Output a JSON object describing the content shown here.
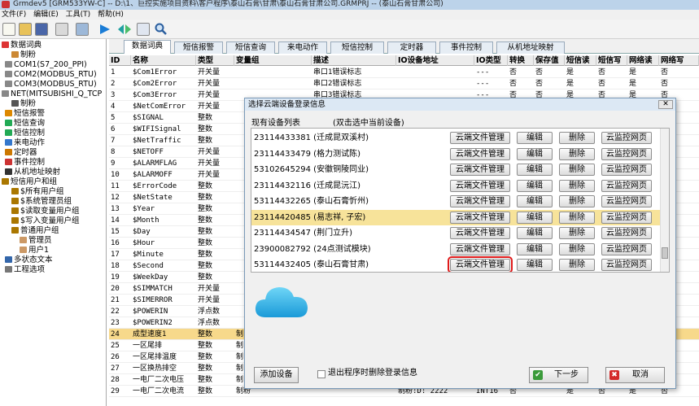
{
  "window": {
    "title": "Grmdev5 [GRM533YW-C] -- D:\\1、巨控实施项目资料\\客户程序\\泰山石膏\\甘肃\\泰山石膏甘肃公司.GRMPRJ -- (泰山石膏甘肃公司)"
  },
  "menu": [
    "文件(F)",
    "编辑(E)",
    "工具(T)",
    "帮助(H)"
  ],
  "tree": [
    {
      "label": "数据词典",
      "color": "#d33"
    },
    {
      "label": "制粉",
      "color": "#c83"
    },
    {
      "label": "COM1(S7_200_PPI)",
      "color": "#888"
    },
    {
      "label": "COM2(MODBUS_RTU)",
      "color": "#888"
    },
    {
      "label": "COM3(MODBUS_RTU)",
      "color": "#888"
    },
    {
      "label": "NET(MITSUBISHI_Q_TCP",
      "color": "#888"
    },
    {
      "label": "制粉",
      "color": "#555"
    },
    {
      "label": "短信报警",
      "color": "#d80"
    },
    {
      "label": "短信查询",
      "color": "#2a5"
    },
    {
      "label": "短信控制",
      "color": "#2a5"
    },
    {
      "label": "来电动作",
      "color": "#37c"
    },
    {
      "label": "定时器",
      "color": "#c70"
    },
    {
      "label": "事件控制",
      "color": "#c33"
    },
    {
      "label": "从机地址映射",
      "color": "#333"
    },
    {
      "label": "短信用户和组",
      "color": "#a70"
    },
    {
      "label": "$所有用户组",
      "color": "#a70"
    },
    {
      "label": "$系统管理员组",
      "color": "#a70"
    },
    {
      "label": "$读取变量用户组",
      "color": "#a70"
    },
    {
      "label": "$写入变量用户组",
      "color": "#a70"
    },
    {
      "label": "普通用户组",
      "color": "#a70"
    },
    {
      "label": "管理员",
      "color": "#c96"
    },
    {
      "label": "用户1",
      "color": "#c96"
    },
    {
      "label": "多状态文本",
      "color": "#36a"
    },
    {
      "label": "工程选项",
      "color": "#777"
    }
  ],
  "tabs": [
    "数据词典",
    "短信报警",
    "短信查询",
    "来电动作",
    "短信控制",
    "定时器",
    "事件控制",
    "从机地址映射"
  ],
  "grid": {
    "headers": [
      "ID",
      "名称",
      "类型",
      "变量组",
      "描述",
      "IO设备地址",
      "IO类型",
      "转换",
      "保存值",
      "短信读",
      "短信写",
      "网络读",
      "网络写"
    ],
    "rows": [
      [
        "1",
        "$Com1Error",
        "开关量",
        "",
        "串口1错误标志",
        "",
        "---",
        "否",
        "否",
        "是",
        "否",
        "是",
        "否"
      ],
      [
        "2",
        "$Com2Error",
        "开关量",
        "",
        "串口2错误标志",
        "",
        "---",
        "否",
        "否",
        "是",
        "否",
        "是",
        "否"
      ],
      [
        "3",
        "$Com3Error",
        "开关量",
        "",
        "串口3错误标志",
        "",
        "---",
        "否",
        "否",
        "是",
        "否",
        "是",
        "否"
      ],
      [
        "4",
        "$NetComError",
        "开关量",
        "",
        "",
        "",
        "",
        "",
        "",
        "",
        "",
        "",
        ""
      ],
      [
        "5",
        "$SIGNAL",
        "整数",
        "",
        "",
        "",
        "",
        "",
        "",
        "",
        "",
        "",
        ""
      ],
      [
        "6",
        "$WIFISignal",
        "整数",
        "",
        "",
        "",
        "",
        "",
        "",
        "",
        "",
        "",
        ""
      ],
      [
        "7",
        "$NetTraffic",
        "整数",
        "",
        "",
        "",
        "",
        "",
        "",
        "",
        "",
        "",
        ""
      ],
      [
        "8",
        "$NETOFF",
        "开关量",
        "",
        "",
        "",
        "",
        "",
        "",
        "",
        "",
        "",
        ""
      ],
      [
        "9",
        "$ALARMFLAG",
        "开关量",
        "",
        "",
        "",
        "",
        "",
        "",
        "",
        "",
        "",
        ""
      ],
      [
        "10",
        "$ALARMOFF",
        "开关量",
        "",
        "",
        "",
        "",
        "",
        "",
        "",
        "",
        "",
        ""
      ],
      [
        "11",
        "$ErrorCode",
        "整数",
        "",
        "",
        "",
        "",
        "",
        "",
        "",
        "",
        "",
        ""
      ],
      [
        "12",
        "$NetState",
        "整数",
        "",
        "",
        "",
        "",
        "",
        "",
        "",
        "",
        "",
        ""
      ],
      [
        "13",
        "$Year",
        "整数",
        "",
        "",
        "",
        "",
        "",
        "",
        "",
        "",
        "",
        ""
      ],
      [
        "14",
        "$Month",
        "整数",
        "",
        "",
        "",
        "",
        "",
        "",
        "",
        "",
        "",
        ""
      ],
      [
        "15",
        "$Day",
        "整数",
        "",
        "",
        "",
        "",
        "",
        "",
        "",
        "",
        "",
        ""
      ],
      [
        "16",
        "$Hour",
        "整数",
        "",
        "",
        "",
        "",
        "",
        "",
        "",
        "",
        "",
        ""
      ],
      [
        "17",
        "$Minute",
        "整数",
        "",
        "",
        "",
        "",
        "",
        "",
        "",
        "",
        "",
        ""
      ],
      [
        "18",
        "$Second",
        "整数",
        "",
        "",
        "",
        "",
        "",
        "",
        "",
        "",
        "",
        ""
      ],
      [
        "19",
        "$WeekDay",
        "整数",
        "",
        "",
        "",
        "",
        "",
        "",
        "",
        "",
        "",
        ""
      ],
      [
        "20",
        "$SIMMATCH",
        "开关量",
        "",
        "",
        "",
        "",
        "",
        "",
        "",
        "",
        "",
        ""
      ],
      [
        "21",
        "$SIMERROR",
        "开关量",
        "",
        "",
        "",
        "",
        "",
        "",
        "",
        "",
        "",
        ""
      ],
      [
        "22",
        "$POWERIN",
        "浮点数",
        "",
        "",
        "",
        "",
        "",
        "",
        "",
        "",
        "",
        ""
      ],
      [
        "23",
        "$POWERIN2",
        "浮点数",
        "",
        "",
        "",
        "",
        "",
        "",
        "",
        "",
        "",
        ""
      ],
      [
        "24",
        "成型速度1",
        "整数",
        "制",
        "",
        "",
        "",
        "",
        "",
        "",
        "",
        "",
        ""
      ],
      [
        "25",
        "一区尾排",
        "整数",
        "制",
        "",
        "",
        "",
        "",
        "",
        "",
        "",
        "",
        ""
      ],
      [
        "26",
        "一区尾排温度",
        "整数",
        "制",
        "",
        "",
        "",
        "",
        "",
        "",
        "",
        "",
        ""
      ],
      [
        "27",
        "一区换热排空",
        "整数",
        "制",
        "",
        "",
        "",
        "",
        "",
        "",
        "",
        "",
        ""
      ],
      [
        "28",
        "一电厂二次电压",
        "整数",
        "制",
        "",
        "",
        "",
        "",
        "",
        "",
        "",
        "",
        ""
      ],
      [
        "29",
        "一电厂二次电流",
        "整数",
        "制粉",
        "",
        "制粉:D: 2222",
        "INT16",
        "否",
        "",
        "是",
        "否",
        "是",
        "否"
      ]
    ]
  },
  "dialog": {
    "title": "选择云端设备登录信息",
    "list_label": "现有设备列表",
    "list_hint": "(双击选中当前设备)",
    "devices": [
      "23114433381 (迁成昆双溪村)",
      "23114433479 (格力测试陈)",
      "53102645294 (安徽铜陵同业)",
      "23114432116 (迁成昆沅江)",
      "53114432265 (泰山石膏忻州)",
      "23114420485 (易志祥, 子宏)",
      "23114434547 (荆门立升)",
      "23900082792 (24点测试模块)",
      "53114432405 (泰山石膏甘肃)"
    ],
    "btn_file": "云端文件管理",
    "btn_edit": "编辑",
    "btn_delete": "删除",
    "btn_web": "云监控网页",
    "add_device": "添加设备",
    "exit_delete_label": "退出程序时删除登录信息",
    "next": "下一步",
    "cancel": "取消"
  }
}
